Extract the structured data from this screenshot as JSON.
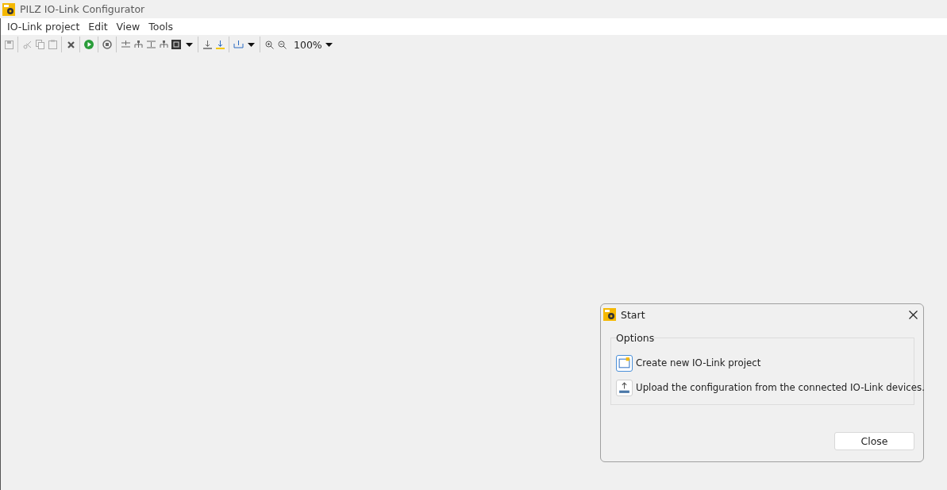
{
  "window": {
    "title": "PILZ IO-Link Configurator"
  },
  "menu": [
    "IO-Link project",
    "Edit",
    "View",
    "Tools"
  ],
  "toolbar": [
    {
      "kind": "save",
      "disabled": true
    },
    {
      "kind": "separator"
    },
    {
      "kind": "cut",
      "disabled": true
    },
    {
      "kind": "copy",
      "disabled": true
    },
    {
      "kind": "paste",
      "disabled": true
    },
    {
      "kind": "separator"
    },
    {
      "kind": "delete",
      "disabled": false
    },
    {
      "kind": "separator"
    },
    {
      "kind": "run",
      "disabled": false
    },
    {
      "kind": "separator"
    },
    {
      "kind": "stop",
      "disabled": false
    },
    {
      "kind": "separator"
    },
    {
      "kind": "align-top",
      "disabled": false
    },
    {
      "kind": "tree",
      "disabled": false
    },
    {
      "kind": "align-middle",
      "disabled": false
    },
    {
      "kind": "tree",
      "disabled": false
    },
    {
      "kind": "device",
      "disabled": false
    },
    {
      "kind": "caret",
      "disabled": false
    },
    {
      "kind": "separator"
    },
    {
      "kind": "download",
      "disabled": false
    },
    {
      "kind": "download-yellow",
      "disabled": false
    },
    {
      "kind": "separator"
    },
    {
      "kind": "upload-tray",
      "disabled": false
    },
    {
      "kind": "caret",
      "disabled": false
    },
    {
      "kind": "separator"
    },
    {
      "kind": "zoom-in",
      "disabled": false
    },
    {
      "kind": "zoom-out",
      "disabled": false
    }
  ],
  "zoom": {
    "value": "100%"
  },
  "dialog": {
    "title": "Start",
    "group_title": "Options",
    "options": [
      {
        "kind": "new",
        "label": "Create new IO-Link project",
        "selected": true
      },
      {
        "kind": "upload",
        "label": "Upload the configuration from the connected IO-Link devices.",
        "selected": false
      }
    ],
    "close_button": "Close"
  }
}
